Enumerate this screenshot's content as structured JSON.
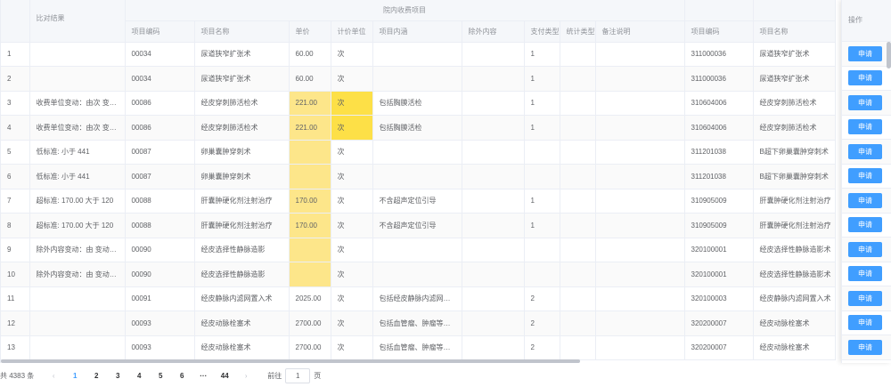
{
  "header": {
    "result": "比对结果",
    "group": "院内收费项目",
    "operation": "操作",
    "columns": [
      "项目编码",
      "项目名称",
      "单价",
      "计价单位",
      "项目内涵",
      "除外内容",
      "支付类型",
      "统计类型",
      "备注说明",
      "项目编码",
      "项目名称"
    ]
  },
  "rows": [
    {
      "idx": "1",
      "result": "",
      "code": "00034",
      "name": "尿道狭窄扩张术",
      "price": "60.00",
      "unit": "次",
      "content": "",
      "excl": "",
      "pay": "1",
      "stat": "",
      "note": "",
      "code2": "311000036",
      "name2": "尿道狭窄扩张术",
      "hl": ""
    },
    {
      "idx": "2",
      "result": "",
      "code": "00034",
      "name": "尿道狭窄扩张术",
      "price": "60.00",
      "unit": "次",
      "content": "",
      "excl": "",
      "pay": "1",
      "stat": "",
      "note": "",
      "code2": "311000036",
      "name2": "尿道狭窄扩张术",
      "hl": ""
    },
    {
      "idx": "3",
      "result": "收费单位变动：由次 变…",
      "code": "00086",
      "name": "经皮穿刺肺活检术",
      "price": "221.00",
      "unit": "次",
      "content": "包括胸膜活检",
      "excl": "",
      "pay": "1",
      "stat": "",
      "note": "",
      "code2": "310604006",
      "name2": "经皮穿刺肺活检术",
      "hl": "both"
    },
    {
      "idx": "4",
      "result": "收费单位变动：由次 变…",
      "code": "00086",
      "name": "经皮穿刺肺活检术",
      "price": "221.00",
      "unit": "次",
      "content": "包括胸膜活检",
      "excl": "",
      "pay": "1",
      "stat": "",
      "note": "",
      "code2": "310604006",
      "name2": "经皮穿刺肺活检术",
      "hl": "both"
    },
    {
      "idx": "5",
      "result": "低标准: 小于 441",
      "code": "00087",
      "name": "卵巢囊肿穿刺术",
      "price": "",
      "unit": "次",
      "content": "",
      "excl": "",
      "pay": "",
      "stat": "",
      "note": "",
      "code2": "311201038",
      "name2": "B超下卵巢囊肿穿刺术",
      "hl": "price"
    },
    {
      "idx": "6",
      "result": "低标准: 小于 441",
      "code": "00087",
      "name": "卵巢囊肿穿刺术",
      "price": "",
      "unit": "次",
      "content": "",
      "excl": "",
      "pay": "",
      "stat": "",
      "note": "",
      "code2": "311201038",
      "name2": "B超下卵巢囊肿穿刺术",
      "hl": "price"
    },
    {
      "idx": "7",
      "result": "超标准: 170.00 大于 120",
      "code": "00088",
      "name": "肝囊肿硬化剂注射治疗",
      "price": "170.00",
      "unit": "次",
      "content": "不含超声定位引导",
      "excl": "",
      "pay": "1",
      "stat": "",
      "note": "",
      "code2": "310905009",
      "name2": "肝囊肿硬化剂注射治疗",
      "hl": "price"
    },
    {
      "idx": "8",
      "result": "超标准: 170.00 大于 120",
      "code": "00088",
      "name": "肝囊肿硬化剂注射治疗",
      "price": "170.00",
      "unit": "次",
      "content": "不含超声定位引导",
      "excl": "",
      "pay": "1",
      "stat": "",
      "note": "",
      "code2": "310905009",
      "name2": "肝囊肿硬化剂注射治疗",
      "hl": "price"
    },
    {
      "idx": "9",
      "result": "除外内容变动：由 变动…",
      "code": "00090",
      "name": "经皮选择性静脉造影",
      "price": "",
      "unit": "次",
      "content": "",
      "excl": "",
      "pay": "",
      "stat": "",
      "note": "",
      "code2": "320100001",
      "name2": "经皮选择性静脉造影术",
      "hl": "price"
    },
    {
      "idx": "10",
      "result": "除外内容变动：由 变动…",
      "code": "00090",
      "name": "经皮选择性静脉造影",
      "price": "",
      "unit": "次",
      "content": "",
      "excl": "",
      "pay": "",
      "stat": "",
      "note": "",
      "code2": "320100001",
      "name2": "经皮选择性静脉造影术",
      "hl": "price"
    },
    {
      "idx": "11",
      "result": "",
      "code": "00091",
      "name": "经皮静脉内滤网置入术",
      "price": "2025.00",
      "unit": "次",
      "content": "包括经皮静脉内滤网…",
      "excl": "",
      "pay": "2",
      "stat": "",
      "note": "",
      "code2": "320100003",
      "name2": "经皮静脉内滤网置入术",
      "hl": ""
    },
    {
      "idx": "12",
      "result": "",
      "code": "00093",
      "name": "经皮动脉栓塞术",
      "price": "2700.00",
      "unit": "次",
      "content": "包括血管瘤、肿瘤等…",
      "excl": "",
      "pay": "2",
      "stat": "",
      "note": "",
      "code2": "320200007",
      "name2": "经皮动脉栓塞术",
      "hl": ""
    },
    {
      "idx": "13",
      "result": "",
      "code": "00093",
      "name": "经皮动脉栓塞术",
      "price": "2700.00",
      "unit": "次",
      "content": "包括血管瘤、肿瘤等…",
      "excl": "",
      "pay": "2",
      "stat": "",
      "note": "",
      "code2": "320200007",
      "name2": "经皮动脉栓塞术",
      "hl": ""
    }
  ],
  "apply_label": "申请",
  "pagination": {
    "total": "共 4383 条",
    "pages": [
      "1",
      "2",
      "3",
      "4",
      "5",
      "6",
      "···",
      "44"
    ],
    "current": "1",
    "goto_label": "前往",
    "goto_value": "1",
    "page_unit": "页"
  },
  "colors": {
    "accent": "#409eff",
    "highlight": "#fde68a",
    "highlight_strong": "#fde047"
  }
}
